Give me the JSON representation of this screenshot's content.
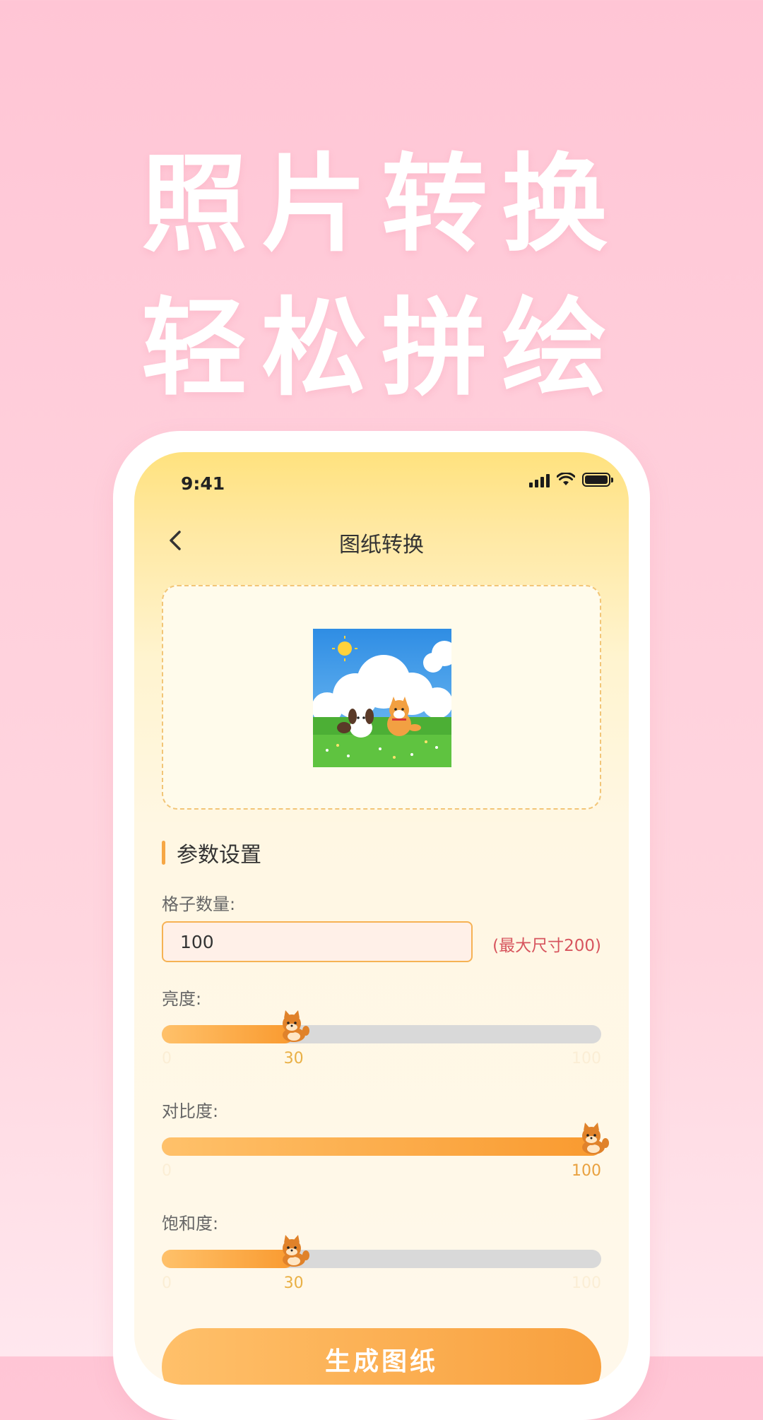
{
  "hero": {
    "line1": "照片转换",
    "line2": "轻松拼绘"
  },
  "status_bar": {
    "time": "9:41"
  },
  "nav": {
    "title": "图纸转换"
  },
  "section": {
    "title": "参数设置"
  },
  "grid_count": {
    "label": "格子数量:",
    "value": "100",
    "max_note": "(最大尺寸200)"
  },
  "sliders": [
    {
      "label": "亮度:",
      "min": "0",
      "max": "100",
      "value": 30,
      "value_text": "30"
    },
    {
      "label": "对比度:",
      "min": "0",
      "max": "100",
      "value": 100,
      "value_text": "100"
    },
    {
      "label": "饱和度:",
      "min": "0",
      "max": "100",
      "value": 30,
      "value_text": "30"
    }
  ],
  "generate_button": {
    "label": "生成图纸"
  },
  "colors": {
    "accent_orange": "#f8a03e",
    "pink_bg": "#ffc5d5",
    "warning_text": "#d7555e"
  }
}
